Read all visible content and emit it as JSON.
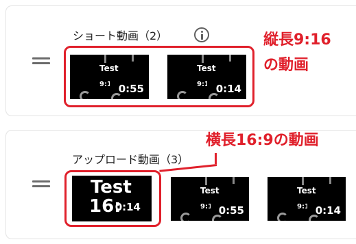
{
  "shorts_section": {
    "title": "ショート動画（2）",
    "info_icon": "info-icon",
    "videos": [
      {
        "title": "Test",
        "ratio": "9:1",
        "duration": "0:55"
      },
      {
        "title": "Test",
        "ratio": "9:1",
        "duration": "0:14"
      }
    ]
  },
  "uploads_section": {
    "title": "アップロード動画（3）",
    "videos": [
      {
        "title": "Test",
        "ratio": "16:9",
        "duration": "0:14"
      },
      {
        "title": "Test",
        "ratio": "9:1",
        "duration": "0:14"
      },
      {
        "title": "Test",
        "ratio": "9:1",
        "duration": "0:55"
      },
      {
        "title": "Test",
        "ratio": "9:1",
        "duration": "0:14"
      }
    ]
  },
  "annotations": {
    "vertical_line1": "縦長9:16",
    "vertical_line2": "の動画",
    "horizontal": "横長16:9の動画",
    "color": "#e0202b"
  }
}
